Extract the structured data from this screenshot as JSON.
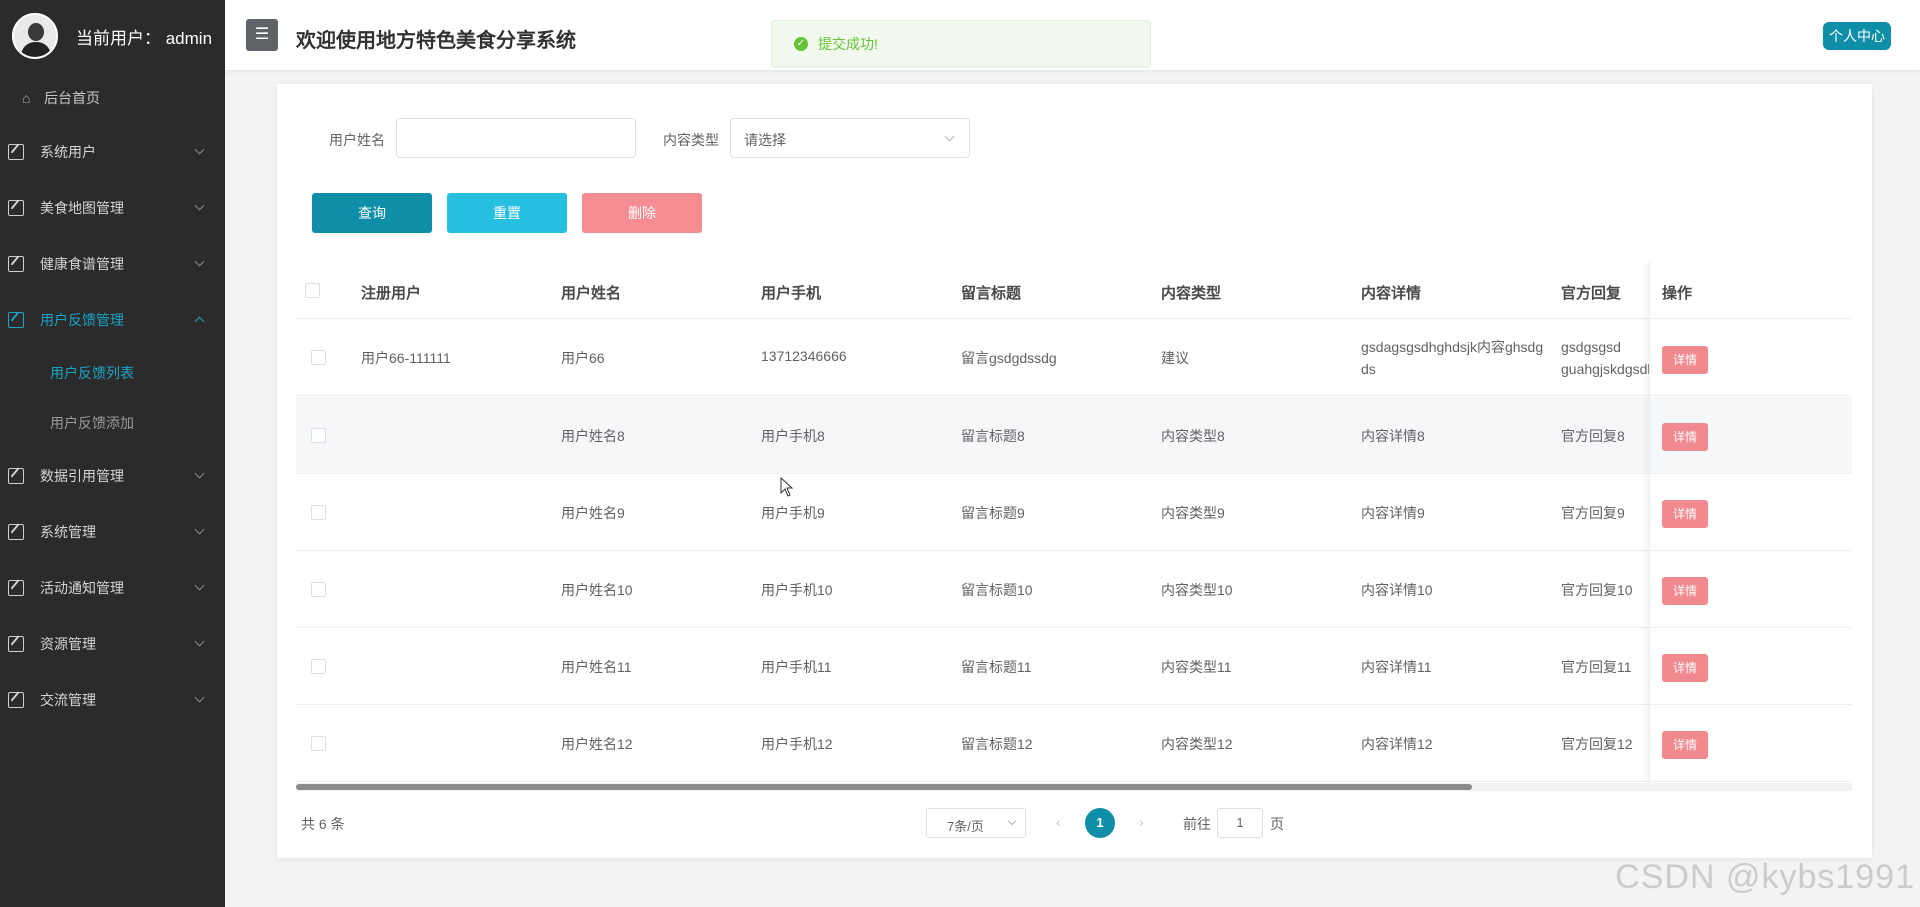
{
  "sidebar": {
    "user_label": "当前用户：  admin",
    "home": "后台首页",
    "menus": [
      {
        "label": "系统用户"
      },
      {
        "label": "美食地图管理"
      },
      {
        "label": "健康食谱管理"
      },
      {
        "label": "用户反馈管理",
        "submenu": [
          "用户反馈列表",
          "用户反馈添加"
        ]
      },
      {
        "label": "数据引用管理"
      },
      {
        "label": "系统管理"
      },
      {
        "label": "活动通知管理"
      },
      {
        "label": "资源管理"
      },
      {
        "label": "交流管理"
      }
    ]
  },
  "header": {
    "menu_icon": "☰",
    "title": "欢迎使用地方特色美食分享系统",
    "center_button": "个人中心"
  },
  "toast": {
    "message": "提交成功!"
  },
  "search": {
    "name_label": "用户姓名",
    "name_value": "",
    "type_label": "内容类型",
    "type_value": "请选择"
  },
  "buttons": {
    "query": "查询",
    "reset": "重置",
    "delete": "删除"
  },
  "table": {
    "headers": [
      "注册用户",
      "用户姓名",
      "用户手机",
      "留言标题",
      "内容类型",
      "内容详情",
      "官方回复",
      "操作"
    ],
    "detail_label": "详情",
    "rows": [
      {
        "user": "用户66-111111",
        "name": "用户66",
        "phone": "13712346666",
        "title": "留言gsdgdssdg",
        "type": "建议",
        "content": "gsdagsgsdhghdsjk内容ghsdgds",
        "reply": "gsdgsgsd guahgjskdgsdkl"
      },
      {
        "user": "",
        "name": "用户姓名8",
        "phone": "用户手机8",
        "title": "留言标题8",
        "type": "内容类型8",
        "content": "内容详情8",
        "reply": "官方回复8"
      },
      {
        "user": "",
        "name": "用户姓名9",
        "phone": "用户手机9",
        "title": "留言标题9",
        "type": "内容类型9",
        "content": "内容详情9",
        "reply": "官方回复9"
      },
      {
        "user": "",
        "name": "用户姓名10",
        "phone": "用户手机10",
        "title": "留言标题10",
        "type": "内容类型10",
        "content": "内容详情10",
        "reply": "官方回复10"
      },
      {
        "user": "",
        "name": "用户姓名11",
        "phone": "用户手机11",
        "title": "留言标题11",
        "type": "内容类型11",
        "content": "内容详情11",
        "reply": "官方回复11"
      },
      {
        "user": "",
        "name": "用户姓名12",
        "phone": "用户手机12",
        "title": "留言标题12",
        "type": "内容类型12",
        "content": "内容详情12",
        "reply": "官方回复12"
      }
    ]
  },
  "pagination": {
    "total": "共 6 条",
    "page_size": "7条/页",
    "prev": "‹",
    "current": "1",
    "next": "›",
    "goto_label": "前往",
    "goto_value": "1",
    "goto_suffix": "页"
  },
  "watermark": "CSDN @kybs1991",
  "colors": {
    "accent": "#0e8fa7",
    "reset": "#27bfe0",
    "delete": "#f58c92",
    "sidebar": "#2b2b2b",
    "active_menu": "#1aa5c7"
  }
}
